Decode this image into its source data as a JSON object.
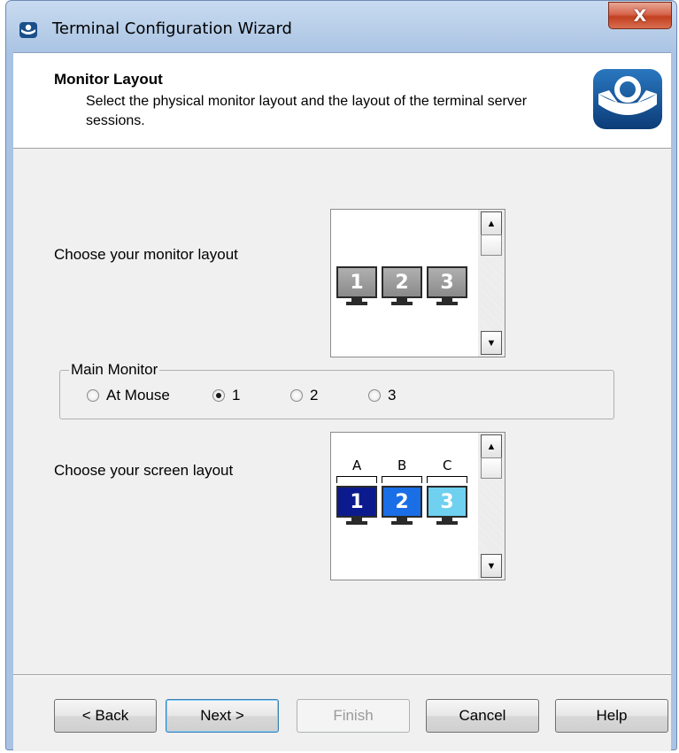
{
  "window": {
    "title": "Terminal Configuration Wizard",
    "close_glyph": "X"
  },
  "header": {
    "title": "Monitor Layout",
    "description": "Select the physical monitor layout and the layout of the terminal server sessions.",
    "logo_icon": "thinmanager-logo-icon"
  },
  "monitor_layout": {
    "label": "Choose your monitor layout",
    "monitors": [
      "1",
      "2",
      "3"
    ],
    "monitor_color": "#9a9a9a"
  },
  "main_monitor": {
    "legend": "Main Monitor",
    "options": [
      {
        "label": "At Mouse",
        "checked": false
      },
      {
        "label": "1",
        "checked": true
      },
      {
        "label": "2",
        "checked": false
      },
      {
        "label": "3",
        "checked": false
      }
    ]
  },
  "screen_layout": {
    "label": "Choose your screen layout",
    "screens": [
      {
        "letter": "A",
        "number": "1",
        "color": "#0b1a8c"
      },
      {
        "letter": "B",
        "number": "2",
        "color": "#1a6ee6"
      },
      {
        "letter": "C",
        "number": "3",
        "color": "#6fd0f0"
      }
    ]
  },
  "buttons": {
    "back": "< Back",
    "next": "Next >",
    "finish": "Finish",
    "cancel": "Cancel",
    "help": "Help"
  }
}
